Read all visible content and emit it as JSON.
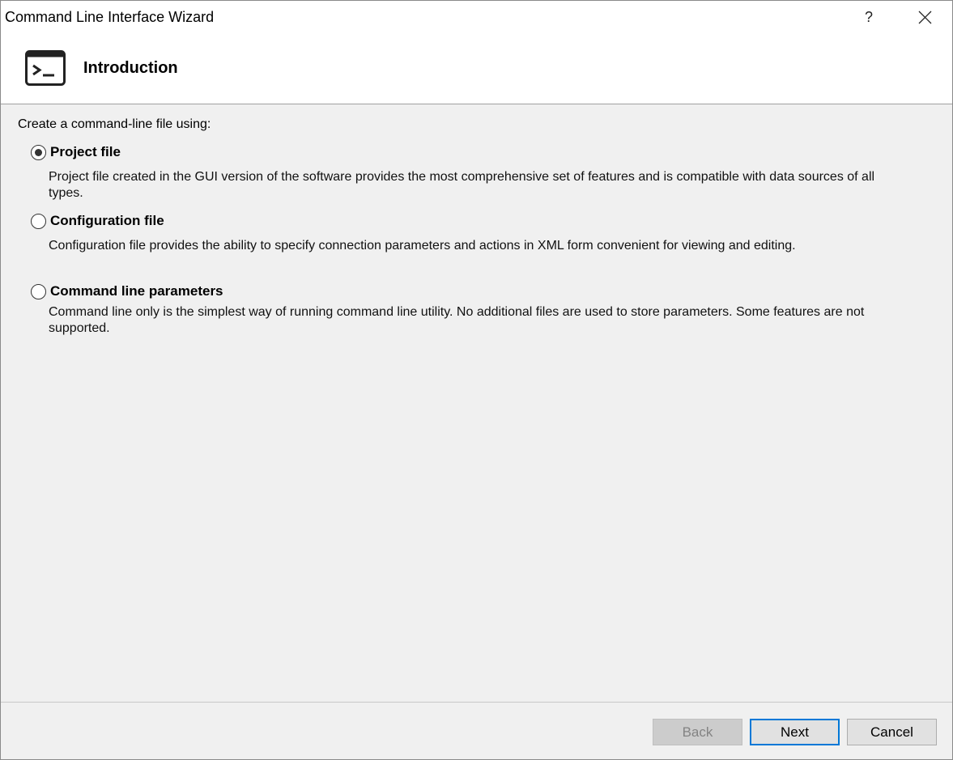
{
  "window": {
    "title": "Command Line Interface Wizard",
    "help_glyph": "?"
  },
  "header": {
    "icon": "terminal-icon",
    "title": "Introduction"
  },
  "content": {
    "prompt": "Create a command-line file using:",
    "options": [
      {
        "label": "Project file",
        "selected": true,
        "description": "Project file created in the GUI version of the software provides the most comprehensive set of features and is compatible with data sources of all types."
      },
      {
        "label": "Configuration file",
        "selected": false,
        "description": "Configuration file provides the ability to specify connection parameters and actions in XML form convenient for viewing and editing."
      },
      {
        "label": "Command line parameters",
        "selected": false,
        "description": "Command line only is the simplest way of running command line utility. No additional files are used to store parameters. Some features are not supported."
      }
    ]
  },
  "footer": {
    "back_label": "Back",
    "back_enabled": false,
    "next_label": "Next",
    "cancel_label": "Cancel"
  },
  "colors": {
    "accent": "#0078d7",
    "background": "#f0f0f0",
    "header_background": "#ffffff"
  }
}
